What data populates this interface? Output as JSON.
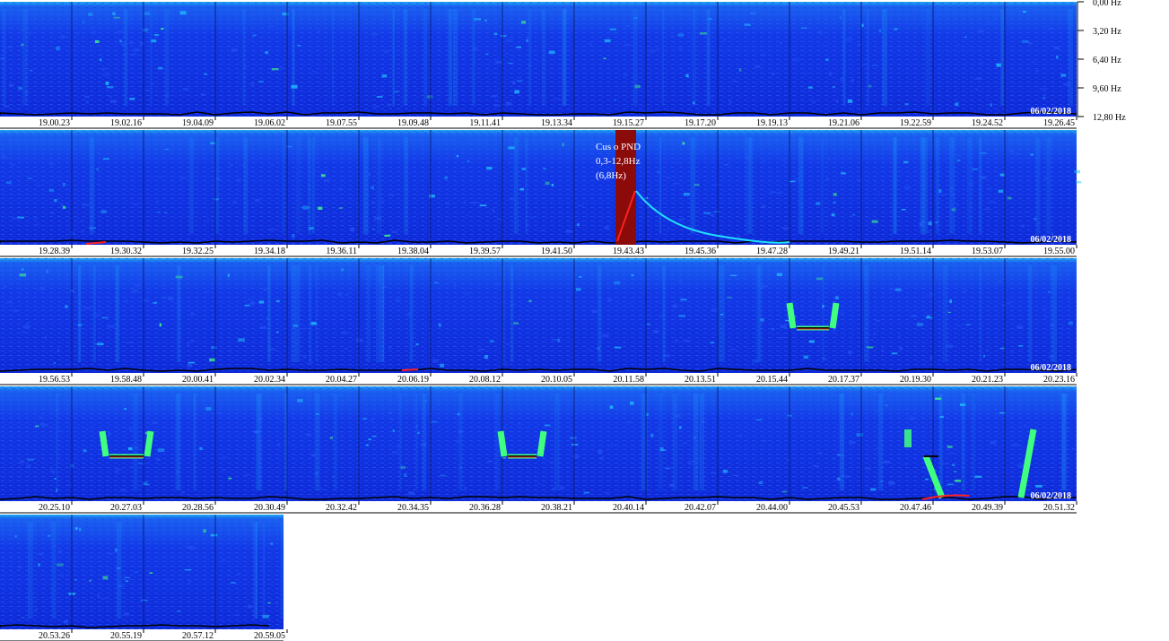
{
  "chart_data": {
    "type": "heatmap",
    "title": "",
    "xlabel": "",
    "ylabel": "",
    "freq_axis": {
      "ticks": [
        "0,00 Hz",
        "3,20 Hz",
        "6,40 Hz",
        "9,60 Hz",
        "12,80 Hz"
      ],
      "range": [
        0,
        12.8
      ],
      "unit": "Hz"
    },
    "rows": [
      {
        "date": "06/02/2018",
        "times": [
          "19.00.23",
          "19.02.16",
          "19.04.09",
          "19.06.02",
          "19.07.55",
          "19.09.48",
          "19.11.41",
          "19.13.34",
          "19.15.27",
          "19.17.20",
          "19.19.13",
          "19.21.06",
          "19.22.59",
          "19.24.52",
          "19.26.45"
        ],
        "events": []
      },
      {
        "date": "06/02/2018",
        "times": [
          "19.28.39",
          "19.30.32",
          "19.32.25",
          "19.34.18",
          "19.36.11",
          "19.38.04",
          "19.39.57",
          "19.41.50",
          "19.43.43",
          "19.45.36",
          "19.47.28",
          "19.49.21",
          "19.51.14",
          "19.53.07",
          "19.55.00"
        ],
        "events": [
          "pnd-marker"
        ]
      },
      {
        "date": "06/02/2018",
        "times": [
          "19.56.53",
          "19.58.48",
          "20.00.41",
          "20.02.34",
          "20.04.27",
          "20.06.19",
          "20.08.12",
          "20.10.05",
          "20.11.58",
          "20.13.51",
          "20.15.44",
          "20.17.37",
          "20.19.30",
          "20.21.23",
          "20.23.16"
        ],
        "events": [
          "bracket"
        ]
      },
      {
        "date": "06/02/2018",
        "times": [
          "20.25.10",
          "20.27.03",
          "20.28.56",
          "20.30.49",
          "20.32.42",
          "20.34.35",
          "20.36.28",
          "20.38.21",
          "20.40.14",
          "20.42.07",
          "20.44.00",
          "20.45.53",
          "20.47.46",
          "20.49.39",
          "20.51.32"
        ],
        "events": [
          "bracket",
          "bracket",
          "bracket-ramp"
        ]
      },
      {
        "date": "",
        "times": [
          "20.53.26",
          "20.55.19",
          "20.57.12",
          "20.59.05"
        ],
        "events": []
      }
    ],
    "annotation": {
      "lines": [
        "Cus o PND",
        "0,3-12,8Hz",
        "(6,8Hz)"
      ]
    }
  },
  "colors": {
    "background": "#1030e8",
    "band": "#2050f0",
    "speckle": "#20c0ff",
    "hot": "#40ff80",
    "marker": "#8b0a0a",
    "trace_up": "#ff2020",
    "trace_decay": "#20e0ff",
    "bracket_line": "#ff3030"
  }
}
